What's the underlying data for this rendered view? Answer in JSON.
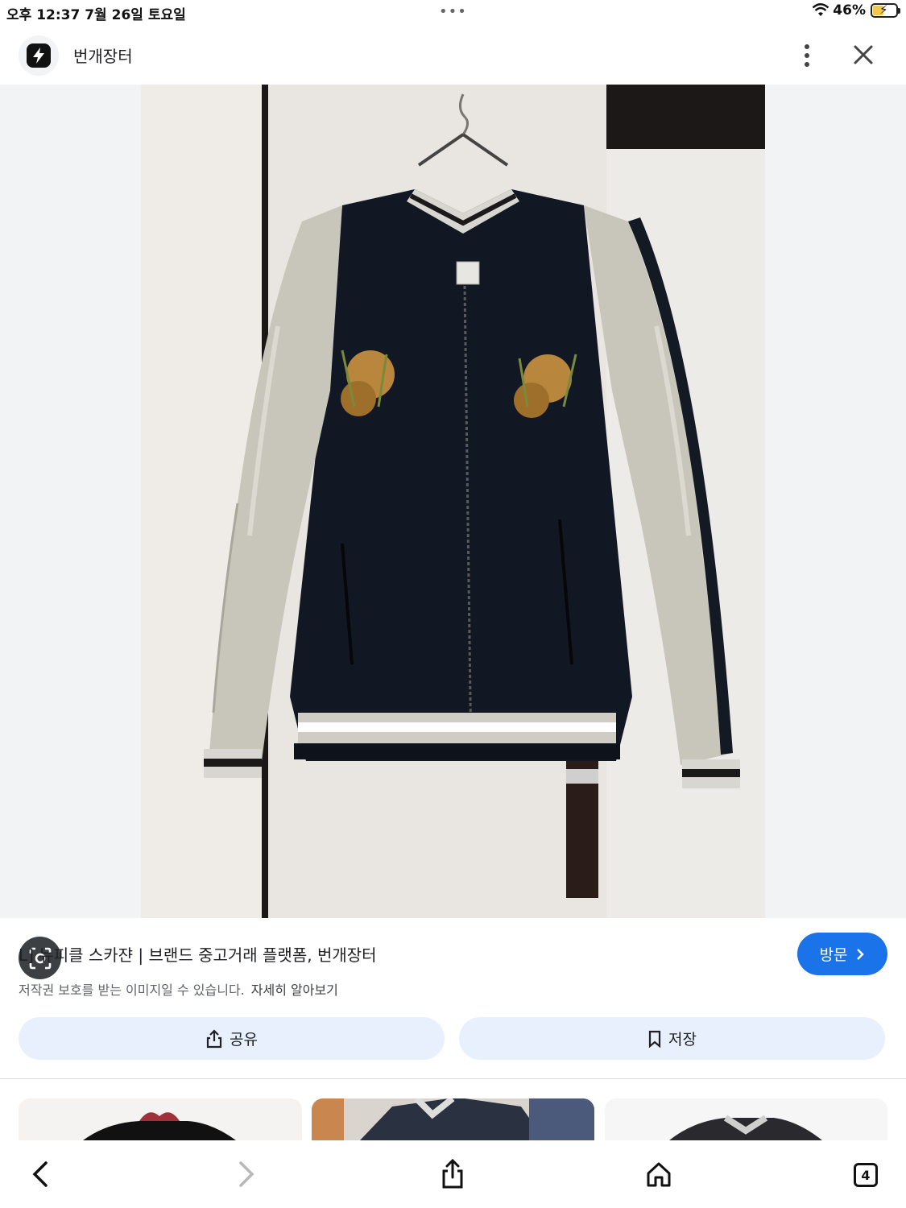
{
  "status_bar": {
    "time": "오후 12:37   7월 26일 토요일",
    "dots": "•••",
    "battery_percent": "46%",
    "battery_level": 0.46
  },
  "header": {
    "site_name": "번개장터",
    "logo_icon": "lightning-bolt-icon"
  },
  "result": {
    "title": "L] 뉴피클 스카쟌 | 브랜드 중고거래 플랫폼, 번개장터",
    "copyright_notice": "저작권 보호를 받는 이미지일 수 있습니다.",
    "learn_more": "자세히 알아보기",
    "visit_label": "방문"
  },
  "actions": {
    "share_label": "공유",
    "save_label": "저장"
  },
  "toolbar": {
    "tabs_count": "4"
  },
  "colors": {
    "accent": "#1a73e8",
    "action_bg": "#e8f0fe",
    "jacket_body": "#101620",
    "jacket_sleeve": "#c9c6bd"
  }
}
